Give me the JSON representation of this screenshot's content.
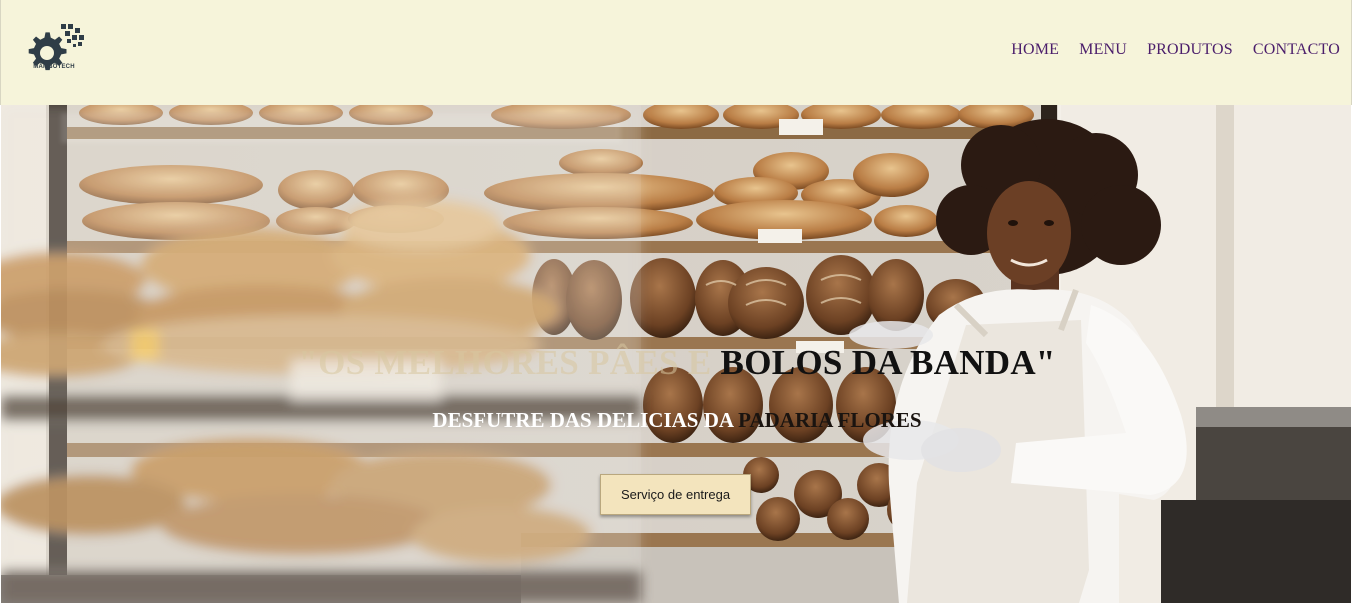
{
  "header": {
    "logo_text": "MAMBOTECH",
    "logo_icon": "gear-with-pixels-icon",
    "nav": [
      {
        "label": "HOME"
      },
      {
        "label": "MENU"
      },
      {
        "label": "PRODUTOS"
      },
      {
        "label": "CONTACTO"
      }
    ]
  },
  "hero": {
    "title_faded": "\"OS MELHORES PÂES E ",
    "title_dark": "BOLOS DA BANDA\"",
    "subtitle_light": "DESFUTRE DAS DELICIAS DA ",
    "subtitle_dark": "PADARIA FLORES",
    "cta_label": "Serviço de entrega",
    "image_subject": "bakery-shelves-with-baker-photo"
  },
  "colors": {
    "header_bg": "#f6f4da",
    "nav_text": "#4b1e6b",
    "cta_bg": "#f3e4bd"
  }
}
